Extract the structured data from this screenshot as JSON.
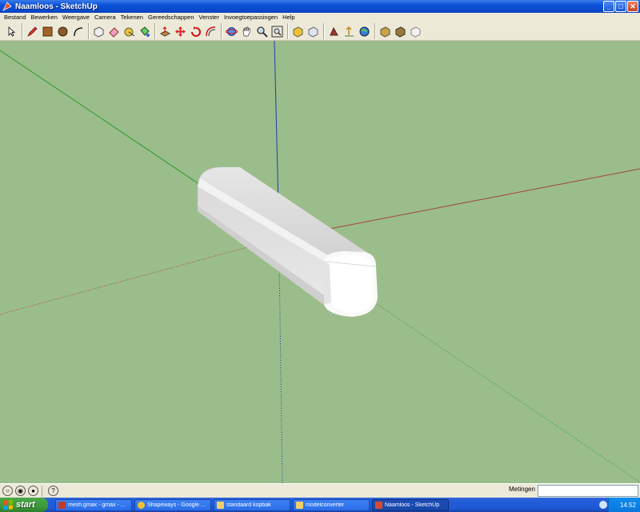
{
  "window": {
    "title": "Naamloos - SketchUp"
  },
  "menu": [
    "Bestand",
    "Bewerken",
    "Weergave",
    "Camera",
    "Tekenen",
    "Gereedschappen",
    "Venster",
    "Invoegtoepassingen",
    "Help"
  ],
  "toolbar_groups": [
    [
      "select-tool-icon"
    ],
    [
      "pencil-line-icon",
      "rectangle-icon",
      "circle-icon",
      "arc-icon"
    ],
    [
      "make-component-icon",
      "eraser-icon",
      "tape-measure-icon",
      "paint-bucket-icon"
    ],
    [
      "push-pull-icon",
      "move-icon",
      "rotate-icon",
      "offset-icon"
    ],
    [
      "orbit-icon",
      "pan-icon",
      "zoom-icon",
      "zoom-extents-icon"
    ],
    [
      "get-models-icon",
      "share-model-icon"
    ],
    [
      "google-earth-icon",
      "place-model-icon",
      "toggle-terrain-icon"
    ],
    [
      "components-icon",
      "share-component-icon",
      "layout-icon"
    ]
  ],
  "statusbar": {
    "measure_label": "Metingen",
    "measure_value": ""
  },
  "taskbar": {
    "start_label": "start",
    "tasks": [
      {
        "label": "mesh.gmax - gmax - ...",
        "color": "#c03b2b"
      },
      {
        "label": "Shapeways - Google ...",
        "color": "#f0c030"
      },
      {
        "label": "standaard kopbak",
        "color": "#f2cf6a"
      },
      {
        "label": "modelconverter",
        "color": "#f2cf6a"
      },
      {
        "label": "Naamloos - SketchUp",
        "color": "#d64a34",
        "active": true
      }
    ],
    "clock": "14:52"
  },
  "colors": {
    "viewport_bg": "#9bbd8b",
    "axis_red": "#a0453a",
    "axis_green": "#2e9a2e",
    "axis_blue": "#2a3aa8"
  }
}
